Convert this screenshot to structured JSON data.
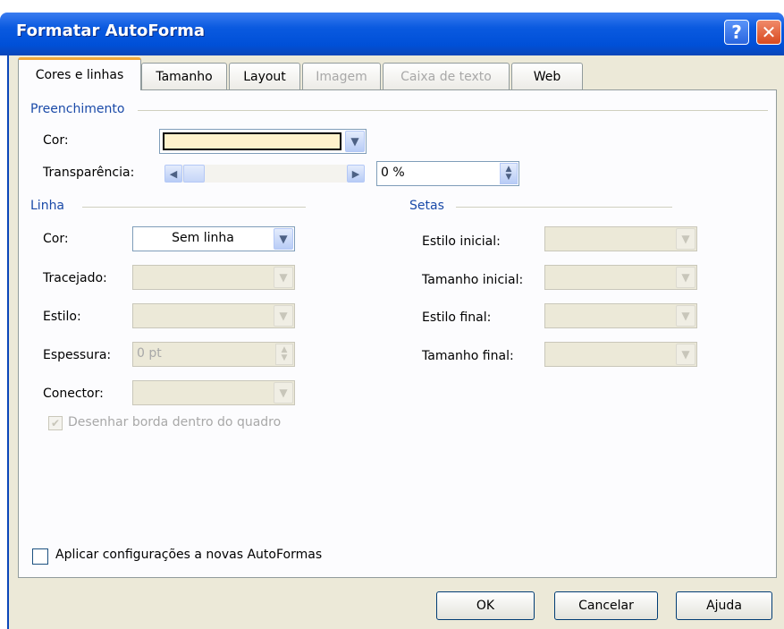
{
  "window": {
    "title": "Formatar AutoForma"
  },
  "tabs": [
    {
      "label": "Cores e linhas",
      "active": true
    },
    {
      "label": "Tamanho"
    },
    {
      "label": "Layout"
    },
    {
      "label": "Imagem",
      "disabled": true
    },
    {
      "label": "Caixa de texto",
      "disabled": true
    },
    {
      "label": "Web"
    }
  ],
  "fill": {
    "section_title": "Preenchimento",
    "color_label": "Cor:",
    "color_value": "#fff2cc",
    "transparency_label": "Transparência:",
    "transparency_value": "0 %"
  },
  "line": {
    "section_title": "Linha",
    "color_label": "Cor:",
    "color_value": "Sem linha",
    "dash_label": "Tracejado:",
    "style_label": "Estilo:",
    "weight_label": "Espessura:",
    "weight_value": "0 pt",
    "connector_label": "Conector:",
    "draw_border_label": "Desenhar borda dentro do quadro"
  },
  "arrows": {
    "section_title": "Setas",
    "begin_style_label": "Estilo inicial:",
    "begin_size_label": "Tamanho inicial:",
    "end_style_label": "Estilo final:",
    "end_size_label": "Tamanho final:"
  },
  "apply_label": "Aplicar configurações a novas AutoFormas",
  "buttons": {
    "ok": "OK",
    "cancel": "Cancelar",
    "help": "Ajuda"
  },
  "icons": {
    "help": "?",
    "close": "✕",
    "dropdown": "▼",
    "left": "◀",
    "right": "▶",
    "up": "▲",
    "down": "▼",
    "check": "✔"
  }
}
